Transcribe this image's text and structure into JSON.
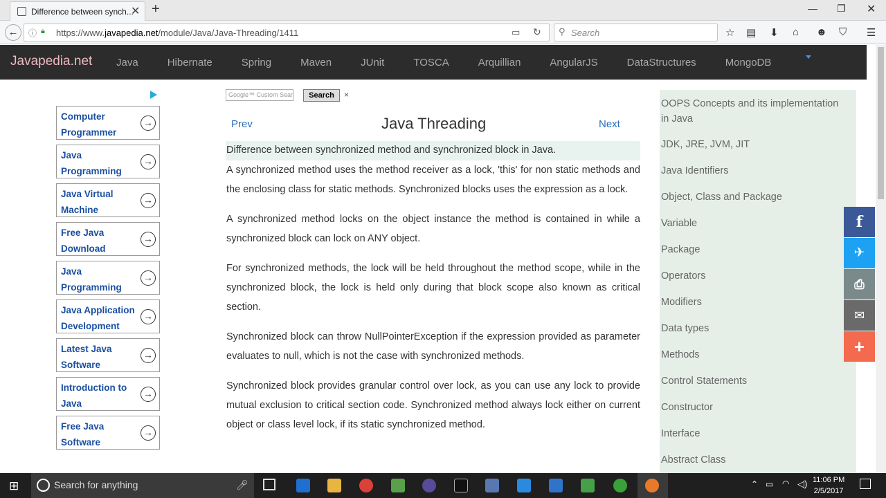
{
  "browser": {
    "tab_title": "Difference between synch...",
    "url_prefix": "https://www.",
    "url_domain": "javapedia.net",
    "url_path": "/module/Java/Java-Threading/1411",
    "search_placeholder": "Search"
  },
  "site": {
    "brand": "Javapedia.net",
    "nav": [
      "Java",
      "Hibernate",
      "Spring",
      "Maven",
      "JUnit",
      "TOSCA",
      "Arquillian",
      "AngularJS",
      "DataStructures",
      "MongoDB"
    ]
  },
  "ads": [
    "Computer Programmer",
    "Java Programming",
    "Java Virtual Machine",
    "Free Java Download",
    "Java Programming",
    "Java Application Development",
    "Latest Java Software",
    "Introduction to Java",
    "Free Java Software"
  ],
  "gsearch": {
    "placeholder": "Google™ Custom Search",
    "button": "Search",
    "close": "×"
  },
  "main": {
    "prev": "Prev",
    "next": "Next",
    "title": "Java Threading",
    "question": "Difference between synchronized method and synchronized block in Java.",
    "paragraphs": [
      "A synchronized method uses the method receiver as a lock, 'this' for non static methods and the enclosing class for static methods. Synchronized blocks uses the expression as a lock.",
      "A synchronized method locks on the object instance the method is contained in while a synchronized block can lock on ANY object.",
      "For synchronized methods, the lock will be held throughout the method scope, while in the synchronized block, the lock is held only during that block scope also known as critical section.",
      "Synchronized block can throw NullPointerException if the expression provided as parameter evaluates to null, which is not the case with synchronized methods.",
      "Synchronized block provides granular control over lock, as you can use any lock to provide mutual exclusion to critical section code. Synchronized method always lock either on current object or class level lock, if its static synchronized method."
    ]
  },
  "topics": [
    "OOPS Concepts and its implementation in Java",
    "JDK, JRE, JVM, JIT",
    "Java Identifiers",
    "Object, Class and Package",
    "Variable",
    "Package",
    "Operators",
    "Modifiers",
    "Data types",
    "Methods",
    "Control Statements",
    "Constructor",
    "Interface",
    "Abstract Class"
  ],
  "taskbar": {
    "search": "Search for anything",
    "time": "11:06 PM",
    "date": "2/5/2017"
  },
  "colors": {
    "navbg": "#2c2c2c",
    "brand": "#f0b8c0",
    "link": "#2a6ebb",
    "facebook": "#3b5998",
    "twitter": "#1da1f2",
    "print": "#7a8a8a",
    "email": "#6a6a6a",
    "more": "#f46a4e"
  }
}
